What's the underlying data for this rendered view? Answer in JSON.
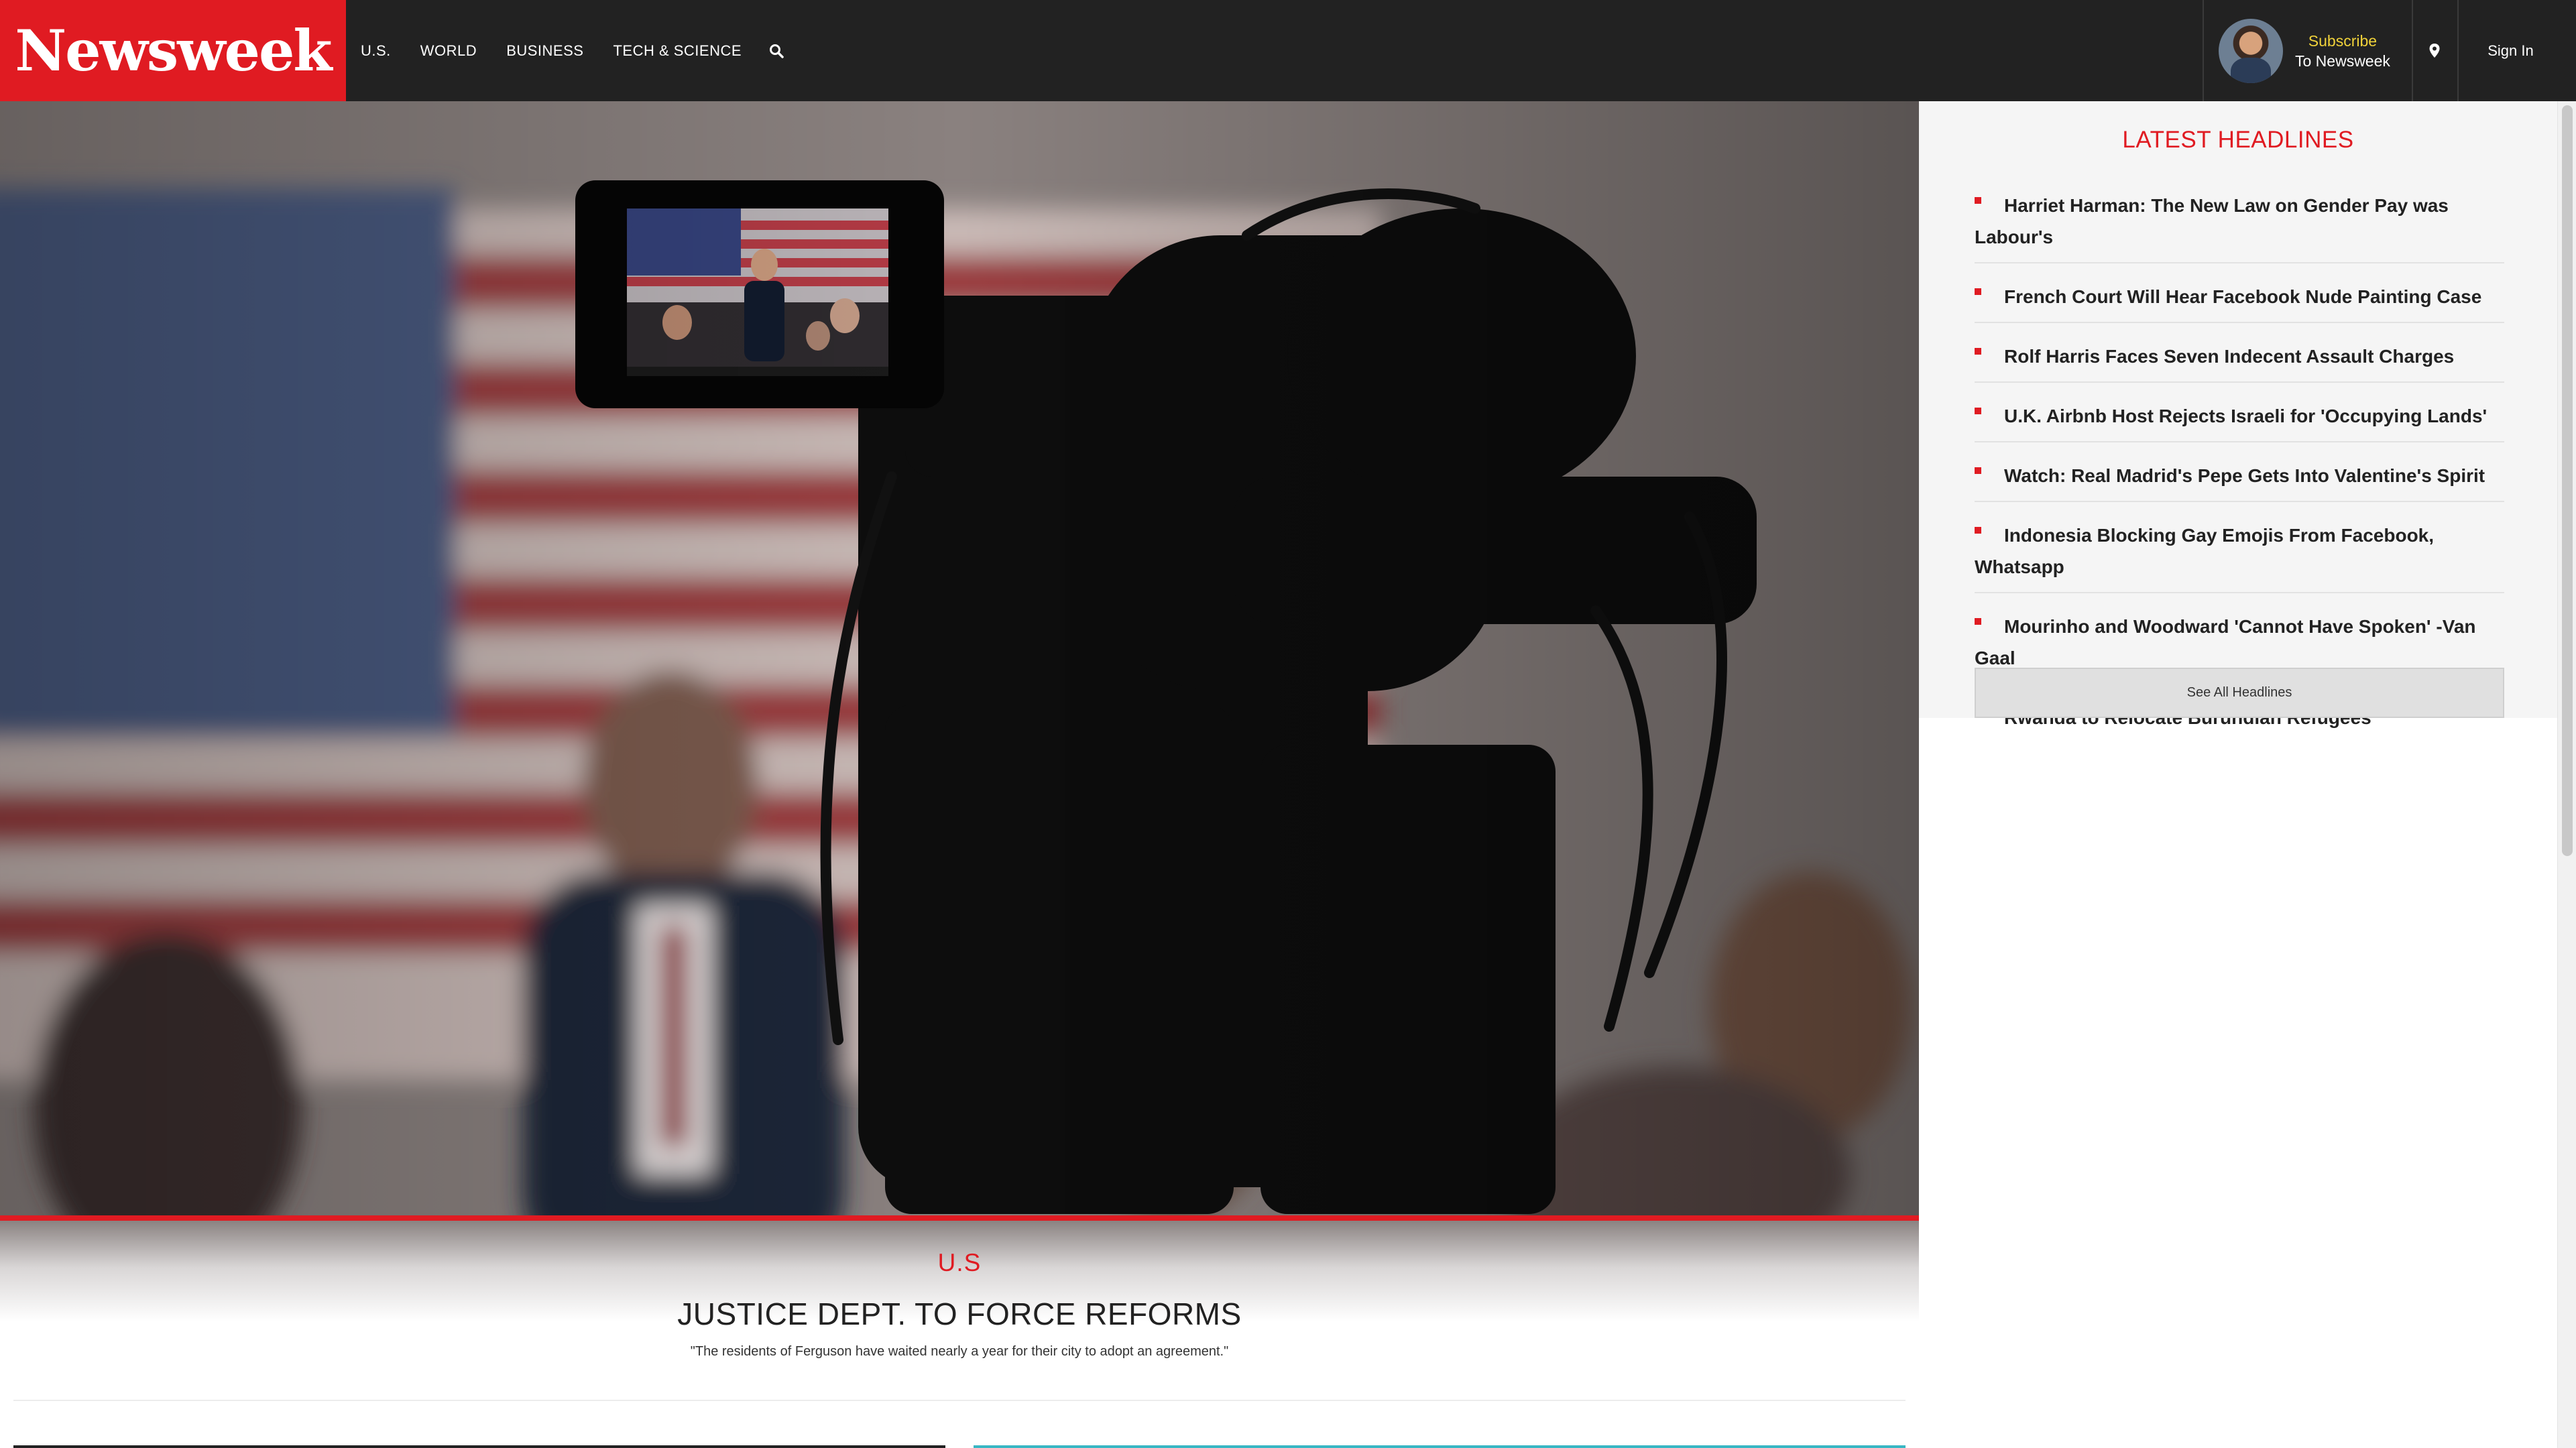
{
  "header": {
    "logo": "Newsweek",
    "nav": [
      "U.S.",
      "WORLD",
      "BUSINESS",
      "TECH & SCIENCE"
    ],
    "subscribe_line1": "Subscribe",
    "subscribe_line2": "To Newsweek",
    "sign_in": "Sign In"
  },
  "hero": {
    "category": "U.S",
    "title": "JUSTICE DEPT. TO FORCE REFORMS",
    "subtitle": "\"The residents of Ferguson have waited nearly a year for their city to adopt an agreement.\""
  },
  "sidebar": {
    "title": "LATEST HEADLINES",
    "headlines": [
      "Harriet Harman: The New Law on Gender Pay was Labour's",
      "French Court Will Hear Facebook Nude Painting Case",
      "Rolf Harris Faces Seven Indecent Assault Charges",
      "U.K. Airbnb Host Rejects Israeli for 'Occupying Lands'",
      "Watch: Real Madrid's Pepe Gets Into Valentine's Spirit",
      "Indonesia Blocking Gay Emojis From Facebook, Whatsapp",
      "Mourinho and Woodward 'Cannot Have Spoken' -Van Gaal",
      "Rwanda to Relocate Burundian Refugees"
    ],
    "see_all": "See All Headlines"
  },
  "colors": {
    "brand_red": "#e01b22",
    "header_bg": "#222222",
    "subscribe_yellow": "#f0d23a",
    "sidebar_bg": "#f5f5f5"
  },
  "icons": {
    "search": "search-icon",
    "location": "location-pin-icon"
  }
}
